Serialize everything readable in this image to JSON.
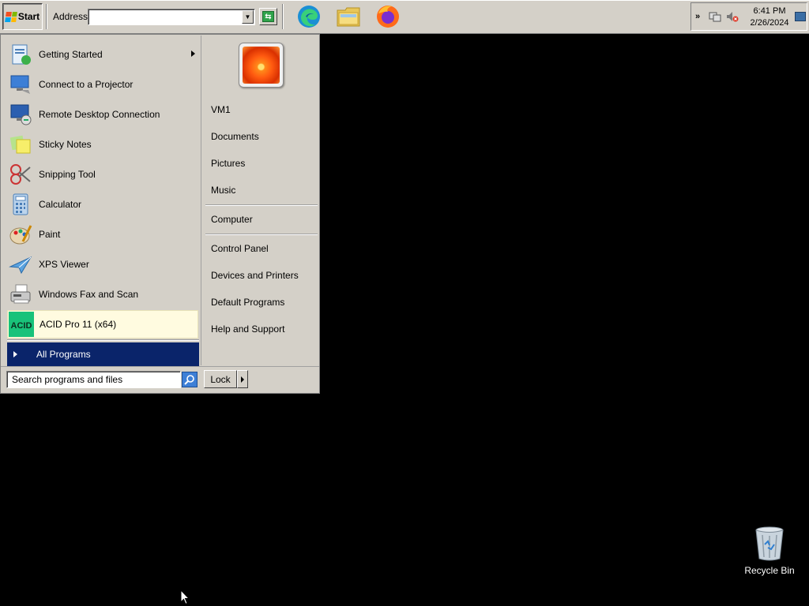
{
  "taskbar": {
    "start_label": "Start",
    "address_label": "Address",
    "address_value": "",
    "quick_launch": [
      {
        "name": "Microsoft Edge",
        "icon": "edge-icon"
      },
      {
        "name": "Windows Explorer",
        "icon": "folder-icon"
      },
      {
        "name": "Firefox",
        "icon": "firefox-icon"
      }
    ],
    "clock": {
      "time": "6:41 PM",
      "date": "2/26/2024"
    }
  },
  "start_menu": {
    "programs": [
      {
        "label": "Getting Started",
        "icon": "getting-started-icon",
        "submenu": true
      },
      {
        "label": "Connect to a Projector",
        "icon": "projector-icon"
      },
      {
        "label": "Remote Desktop Connection",
        "icon": "remote-desktop-icon"
      },
      {
        "label": "Sticky Notes",
        "icon": "sticky-notes-icon"
      },
      {
        "label": "Snipping Tool",
        "icon": "scissors-icon"
      },
      {
        "label": "Calculator",
        "icon": "calculator-icon"
      },
      {
        "label": "Paint",
        "icon": "paint-icon"
      },
      {
        "label": "XPS Viewer",
        "icon": "xps-viewer-icon"
      },
      {
        "label": "Windows Fax and Scan",
        "icon": "fax-icon"
      },
      {
        "label": "ACID Pro 11 (x64)",
        "icon": "acid-icon",
        "icon_text": "ACID",
        "highlighted": true
      }
    ],
    "all_programs": "All Programs",
    "right_links": {
      "user": "VM1",
      "documents": "Documents",
      "pictures": "Pictures",
      "music": "Music",
      "computer": "Computer",
      "control_panel": "Control Panel",
      "devices": "Devices and Printers",
      "default_programs": "Default Programs",
      "help": "Help and Support"
    },
    "search_placeholder": "Search programs and files",
    "lock_label": "Lock"
  },
  "desktop": {
    "recycle_bin": "Recycle Bin"
  },
  "colors": {
    "taskbar_bg": "#d4d0c8",
    "selection": "#0a246a",
    "highlight_item": "#fffbe0",
    "desktop": "#000000"
  }
}
